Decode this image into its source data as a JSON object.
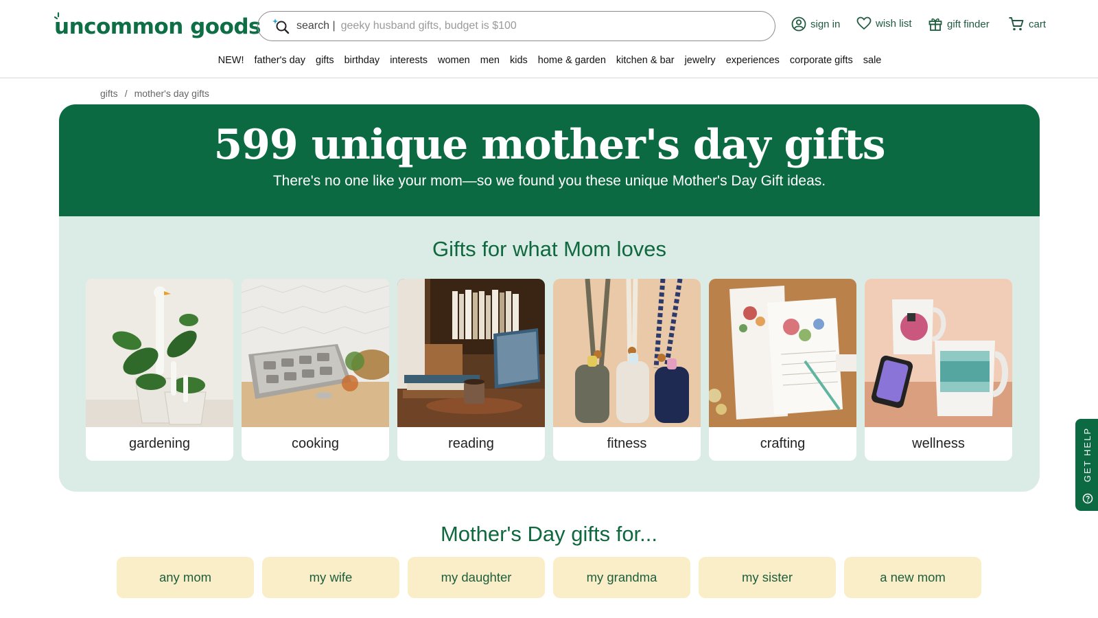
{
  "brand": {
    "logo_text": "uncommon goods",
    "accent": "#0b6a41",
    "text_green": "#10683f",
    "pill_color": "#faeec9",
    "band_color": "#dbece6"
  },
  "header": {
    "search": {
      "prefix": "search |",
      "placeholder": "geeky husband gifts, budget is $100",
      "icon": "sparkle-search-icon"
    },
    "utilities": [
      {
        "label": "sign in",
        "icon": "user-circle-icon"
      },
      {
        "label": "wish list",
        "icon": "heart-icon"
      },
      {
        "label": "gift finder",
        "icon": "gift-icon"
      },
      {
        "label": "cart",
        "icon": "cart-icon"
      }
    ]
  },
  "nav": [
    "NEW!",
    "father's day",
    "gifts",
    "birthday",
    "interests",
    "women",
    "men",
    "kids",
    "home & garden",
    "kitchen & bar",
    "jewelry",
    "experiences",
    "corporate gifts",
    "sale"
  ],
  "breadcrumb": {
    "items": [
      "gifts",
      "mother's day gifts"
    ],
    "separator": "/"
  },
  "hero": {
    "title": "599 unique mother's day gifts",
    "subtitle": "There's no one like your mom—so we found you these unique Mother's Day Gift ideas."
  },
  "loves": {
    "heading": "Gifts for what Mom loves",
    "cards": [
      {
        "label": "gardening"
      },
      {
        "label": "cooking"
      },
      {
        "label": "reading"
      },
      {
        "label": "fitness"
      },
      {
        "label": "crafting"
      },
      {
        "label": "wellness"
      }
    ]
  },
  "gifts_for": {
    "heading": "Mother's Day gifts for...",
    "pills": [
      "any mom",
      "my wife",
      "my daughter",
      "my grandma",
      "my sister",
      "a new mom"
    ]
  },
  "help_tab": {
    "label": "GET HELP",
    "icon": "question-circle-icon"
  }
}
